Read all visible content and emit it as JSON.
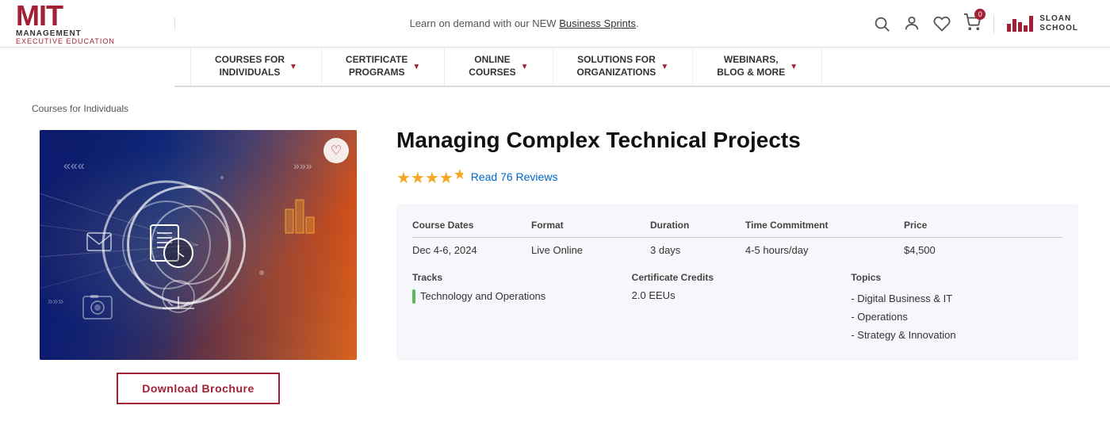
{
  "topbar": {
    "announcement": "Learn on demand with our NEW ",
    "announcement_link": "Business Sprints",
    "announcement_suffix": ".",
    "mit_text": "MIT",
    "management_text": "MANAGEMENT",
    "executive_text": "EXECUTIVE EDUCATION",
    "sloan_line1": "SLOAN",
    "sloan_line2": "SCHOOL",
    "cart_count": "0"
  },
  "nav": {
    "items": [
      {
        "label": "COURSES FOR\nINDIVIDUALS"
      },
      {
        "label": "CERTIFICATE\nPROGRAMS"
      },
      {
        "label": "ONLINE\nCOURSES"
      },
      {
        "label": "SOLUTIONS FOR\nORGANIZATIONS"
      },
      {
        "label": "WEBINARS,\nBLOG & MORE"
      }
    ]
  },
  "breadcrumb": "Courses for Individuals",
  "course": {
    "title": "Managing Complex Technical Projects",
    "stars": "★★★★",
    "half_star": "½",
    "reviews_link": "Read 76 Reviews",
    "table": {
      "headers": [
        "Course Dates",
        "Format",
        "Duration",
        "Time Commitment",
        "Price"
      ],
      "row": [
        "Dec 4-6, 2024",
        "Live Online",
        "3 days",
        "4-5 hours/day",
        "$4,500"
      ]
    },
    "tracks_label": "Tracks",
    "track_name": "Technology and Operations",
    "credits_label": "Certificate Credits",
    "credits_value": "2.0 EEUs",
    "topics_label": "Topics",
    "topics": [
      "- Digital Business & IT",
      "- Operations",
      "- Strategy & Innovation"
    ]
  },
  "buttons": {
    "download_brochure": "Download Brochure"
  }
}
